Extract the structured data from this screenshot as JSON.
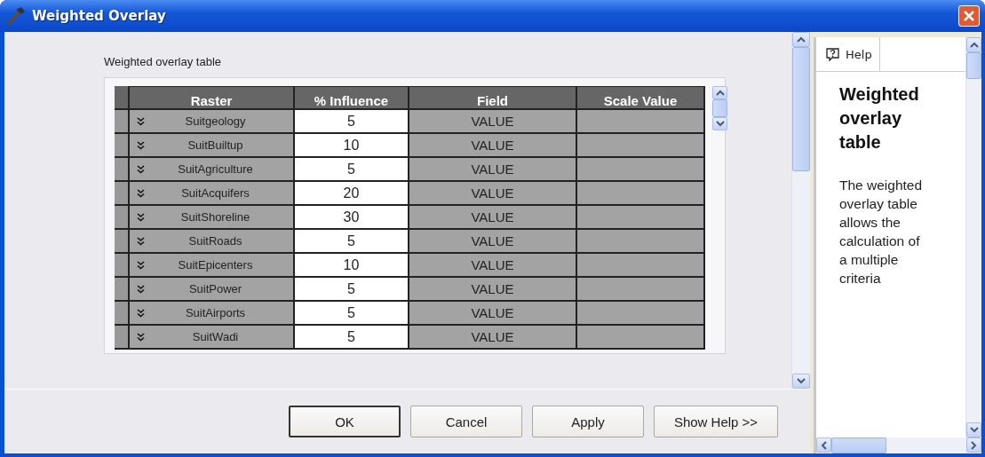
{
  "window": {
    "title": "Weighted Overlay"
  },
  "table_label": "Weighted overlay table",
  "table": {
    "columns": [
      "Raster",
      "% Influence",
      "Field",
      "Scale Value"
    ],
    "rows": [
      {
        "raster": "Suitgeology",
        "influence": "5",
        "field": "VALUE"
      },
      {
        "raster": "SuitBuiltup",
        "influence": "10",
        "field": "VALUE"
      },
      {
        "raster": "SuitAgriculture",
        "influence": "5",
        "field": "VALUE"
      },
      {
        "raster": "SuitAcquifers",
        "influence": "20",
        "field": "VALUE"
      },
      {
        "raster": "SuitShoreline",
        "influence": "30",
        "field": "VALUE"
      },
      {
        "raster": "SuitRoads",
        "influence": "5",
        "field": "VALUE"
      },
      {
        "raster": "SuitEpicenters",
        "influence": "10",
        "field": "VALUE"
      },
      {
        "raster": "SuitPower",
        "influence": "5",
        "field": "VALUE"
      },
      {
        "raster": "SuitAirports",
        "influence": "5",
        "field": "VALUE"
      },
      {
        "raster": "SuitWadi",
        "influence": "5",
        "field": "VALUE"
      }
    ]
  },
  "buttons": [
    {
      "label": "OK",
      "default": true
    },
    {
      "label": "Cancel",
      "default": false
    },
    {
      "label": "Apply",
      "default": false
    },
    {
      "label": "Show Help >>",
      "default": false
    }
  ],
  "help": {
    "tab": "Help",
    "heading": "Weighted overlay table",
    "body": "The weighted overlay table allows the calculation of a multiple criteria"
  }
}
